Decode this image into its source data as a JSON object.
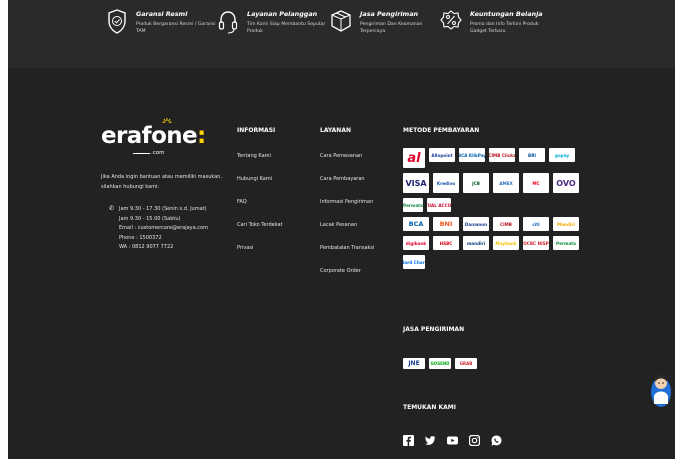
{
  "features": [
    {
      "icon": "shield-check-icon",
      "title": "Garansi Resmi",
      "desc": "Produk Bergaransi Resmi / Garansi TAM"
    },
    {
      "icon": "headset-icon",
      "title": "Layanan Pelanggan",
      "desc": "Tim Kami Siap Membantu Seputar Produk"
    },
    {
      "icon": "package-icon",
      "title": "Jasa Pengiriman",
      "desc": "Pengiriman Dan Keamanan Terpercaya"
    },
    {
      "icon": "discount-badge-icon",
      "title": "Keuntungan Belanja",
      "desc": "Promo dan Info Terkini Produk Gadget Terbaru"
    }
  ],
  "brand": {
    "name": "erafone",
    "suffix": ".com"
  },
  "contact": {
    "intro": "Jika Anda ingin bantuan atau memiliki masukan, silahkan hubungi kami:",
    "lines": [
      "Jam 9.30 - 17.30 (Senin s.d. Jumat)",
      "Jam 9.30 - 15.00 (Sabtu)",
      "Email : customercare@erajaya.com",
      "Phone : 1500372",
      "WA : 0812 9077 7722"
    ]
  },
  "info": {
    "heading": "INFORMASI",
    "links": [
      "Tentang Kami",
      "Hubungi Kami",
      "FAQ",
      "Cari Toko Terdekat",
      "Privasi"
    ]
  },
  "service": {
    "heading": "LAYANAN",
    "links": [
      "Cara Pemesanan",
      "Cara Pembayaran",
      "Informasi Pengiriman",
      "Lacak Pesanan",
      "Pembatalan Transaksi",
      "Corporate Order"
    ]
  },
  "payment": {
    "heading": "METODE PEMBAYARAN",
    "rows": [
      [
        {
          "label": "al",
          "color": "#e4002b",
          "name": "akulaku-logo"
        },
        {
          "label": "Allopoint",
          "color": "#1a3e9b",
          "name": "allopoint-logo"
        },
        {
          "label": "BCA KlikPay",
          "color": "#0060af",
          "name": "bca-klikpay-logo"
        },
        {
          "label": "CIMB Clicks",
          "color": "#b5121b",
          "name": "cimb-clicks-logo"
        },
        {
          "label": "BRI",
          "color": "#00529c",
          "name": "bri-logo"
        },
        {
          "label": "gopay",
          "color": "#00aed6",
          "name": "gopay-logo"
        }
      ],
      [
        {
          "label": "VISA",
          "color": "#1a1f71",
          "name": "visa-logo"
        },
        {
          "label": "Kredivo",
          "color": "#0a4fa3",
          "name": "kredivo-logo"
        },
        {
          "label": "JCB",
          "color": "#0a5a2a",
          "name": "jcb-logo"
        },
        {
          "label": "AMEX",
          "color": "#2a6ebb",
          "name": "amex-logo"
        },
        {
          "label": "MC",
          "color": "#eb001b",
          "name": "mastercard-logo"
        },
        {
          "label": "OVO",
          "color": "#4c2a86",
          "name": "ovo-logo"
        }
      ],
      [
        {
          "label": "Permata",
          "color": "#0c8a3b",
          "name": "permata-logo"
        },
        {
          "label": "VIRTUAL ACCOUNT",
          "color": "#c8102e",
          "name": "virtual-account-logo"
        }
      ],
      [
        {
          "label": "BCA",
          "color": "#0060af",
          "name": "bca-logo"
        },
        {
          "label": "BNI",
          "color": "#f15a22",
          "name": "bni-logo"
        },
        {
          "label": "Danamon",
          "color": "#1b3f8b",
          "name": "danamon-logo"
        },
        {
          "label": "CIMB",
          "color": "#b5121b",
          "name": "cimb-logo"
        },
        {
          "label": "citi",
          "color": "#0a5fb4",
          "name": "citi-logo"
        },
        {
          "label": "Mandiri",
          "color": "#f7a800",
          "name": "mandiri-logo"
        }
      ],
      [
        {
          "label": "digibank",
          "color": "#e4002b",
          "name": "digibank-logo"
        },
        {
          "label": "HSBC",
          "color": "#db0011",
          "name": "hsbc-logo"
        },
        {
          "label": "mandiri",
          "color": "#003d79",
          "name": "mandiri-cc-logo"
        },
        {
          "label": "Maybank",
          "color": "#f4c300",
          "name": "maybank-logo"
        },
        {
          "label": "OCBC NISP",
          "color": "#d2232a",
          "name": "ocbc-logo"
        },
        {
          "label": "Permata",
          "color": "#0c8a3b",
          "name": "permata-cc-logo"
        }
      ],
      [
        {
          "label": "Standard Chartered",
          "color": "#0473ea",
          "name": "standard-chartered-logo"
        }
      ]
    ]
  },
  "shipping": {
    "heading": "JASA PENGIRIMAN",
    "items": [
      {
        "label": "JNE",
        "color": "#1b3f8b",
        "name": "jne-logo"
      },
      {
        "label": "GOSEND",
        "color": "#00aa13",
        "name": "gosend-logo"
      },
      {
        "label": "GRAB",
        "color": "#d2232a",
        "name": "grab-logo"
      }
    ]
  },
  "social": {
    "heading": "TEMUKAN KAMI",
    "items": [
      "facebook-icon",
      "twitter-icon",
      "youtube-icon",
      "instagram-icon",
      "whatsapp-icon"
    ]
  }
}
